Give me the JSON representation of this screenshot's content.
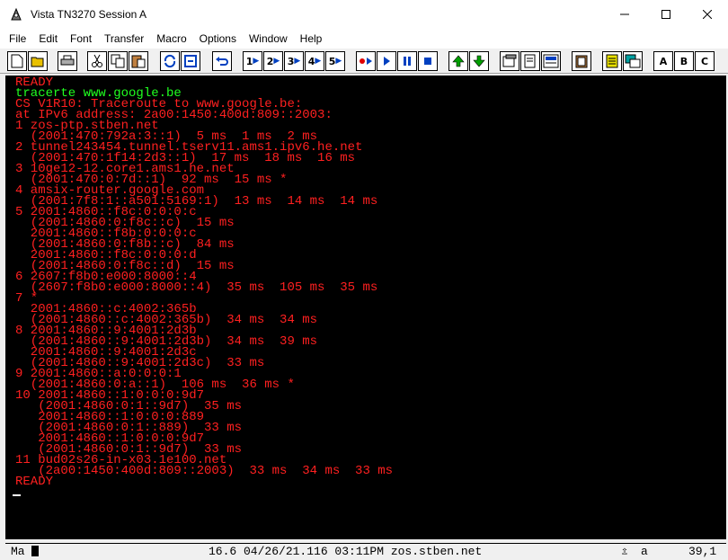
{
  "window": {
    "title": "Vista TN3270 Session A"
  },
  "menu": [
    "File",
    "Edit",
    "Font",
    "Transfer",
    "Macro",
    "Options",
    "Window",
    "Help"
  ],
  "toolbar": {
    "session_buttons": [
      "1",
      "2",
      "3",
      "4",
      "5"
    ],
    "letter_buttons": [
      "A",
      "B",
      "C"
    ]
  },
  "terminal": {
    "lines": [
      {
        "text": "READY",
        "color": "red"
      },
      {
        "text": "tracerte www.google.be",
        "color": "green"
      },
      {
        "text": "CS V1R10: Traceroute to www.google.be:",
        "color": "red"
      },
      {
        "text": "at IPv6 address: 2a00:1450:400d:809::2003:",
        "color": "red"
      },
      {
        "text": "1 zos-ptp.stben.net",
        "color": "red"
      },
      {
        "text": "  (2001:470:792a:3::1)  5 ms  1 ms  2 ms",
        "color": "red"
      },
      {
        "text": "2 tunnel243454.tunnel.tserv11.ams1.ipv6.he.net",
        "color": "red"
      },
      {
        "text": "  (2001:470:1f14:2d3::1)  17 ms  18 ms  16 ms",
        "color": "red"
      },
      {
        "text": "3 10ge12-12.core1.ams1.he.net",
        "color": "red"
      },
      {
        "text": "  (2001:470:0:7d::1)  92 ms  15 ms *",
        "color": "red"
      },
      {
        "text": "4 amsix-router.google.com",
        "color": "red"
      },
      {
        "text": "  (2001:7f8:1::a501:5169:1)  13 ms  14 ms  14 ms",
        "color": "red"
      },
      {
        "text": "5 2001:4860::f8c:0:0:0:c",
        "color": "red"
      },
      {
        "text": "  (2001:4860:0:f8c::c)  15 ms",
        "color": "red"
      },
      {
        "text": "  2001:4860::f8b:0:0:0:c",
        "color": "red"
      },
      {
        "text": "  (2001:4860:0:f8b::c)  84 ms",
        "color": "red"
      },
      {
        "text": "  2001:4860::f8c:0:0:0:d",
        "color": "red"
      },
      {
        "text": "  (2001:4860:0:f8c::d)  15 ms",
        "color": "red"
      },
      {
        "text": "6 2607:f8b0:e000:8000::4",
        "color": "red"
      },
      {
        "text": "  (2607:f8b0:e000:8000::4)  35 ms  105 ms  35 ms",
        "color": "red"
      },
      {
        "text": "7 *",
        "color": "red"
      },
      {
        "text": "  2001:4860::c:4002:365b",
        "color": "red"
      },
      {
        "text": "  (2001:4860::c:4002:365b)  34 ms  34 ms",
        "color": "red"
      },
      {
        "text": "8 2001:4860::9:4001:2d3b",
        "color": "red"
      },
      {
        "text": "  (2001:4860::9:4001:2d3b)  34 ms  39 ms",
        "color": "red"
      },
      {
        "text": "  2001:4860::9:4001:2d3c",
        "color": "red"
      },
      {
        "text": "  (2001:4860::9:4001:2d3c)  33 ms",
        "color": "red"
      },
      {
        "text": "9 2001:4860::a:0:0:0:1",
        "color": "red"
      },
      {
        "text": "  (2001:4860:0:a::1)  106 ms  36 ms *",
        "color": "red"
      },
      {
        "text": "10 2001:4860::1:0:0:0:9d7",
        "color": "red"
      },
      {
        "text": "   (2001:4860:0:1::9d7)  35 ms",
        "color": "red"
      },
      {
        "text": "   2001:4860::1:0:0:0:889",
        "color": "red"
      },
      {
        "text": "   (2001:4860:0:1::889)  33 ms",
        "color": "red"
      },
      {
        "text": "   2001:4860::1:0:0:0:9d7",
        "color": "red"
      },
      {
        "text": "   (2001:4860:0:1::9d7)  33 ms",
        "color": "red"
      },
      {
        "text": "11 bud02s26-in-x03.1e100.net",
        "color": "red"
      },
      {
        "text": "   (2a00:1450:400d:809::2003)  33 ms  34 ms  33 ms",
        "color": "red"
      },
      {
        "text": "READY",
        "color": "red"
      }
    ]
  },
  "status": {
    "mode": "Ma",
    "info": "16.6 04/26/21.116 03:11PM zos.stben.net",
    "shift": "a",
    "cursor_pos": "39,1"
  },
  "colors": {
    "terminal_bg": "#000000",
    "text_red": "#ff2020",
    "text_green": "#20ff20"
  }
}
